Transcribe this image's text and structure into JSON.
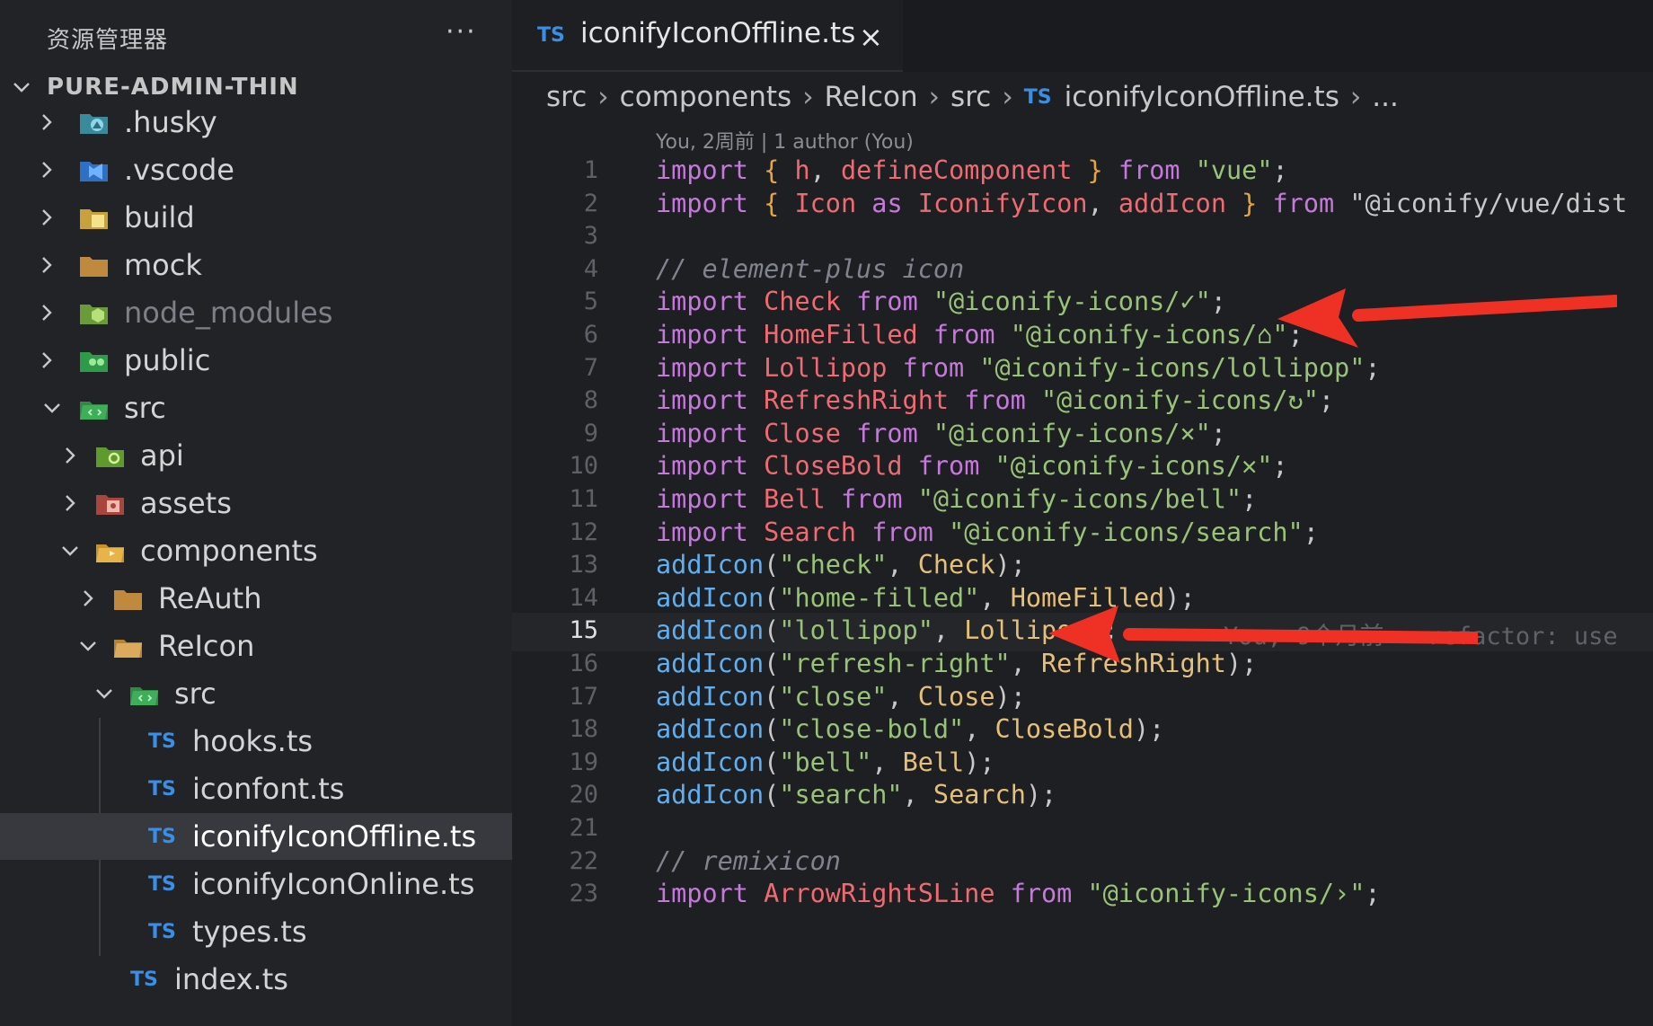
{
  "sidebar": {
    "title": "资源管理器",
    "more": "···",
    "root": "PURE-ADMIN-THIN",
    "items": [
      {
        "label": ".husky",
        "kind": "folder",
        "expanded": false
      },
      {
        "label": ".vscode",
        "kind": "folder",
        "expanded": false
      },
      {
        "label": "build",
        "kind": "folder",
        "expanded": false
      },
      {
        "label": "mock",
        "kind": "folder",
        "expanded": false
      },
      {
        "label": "node_modules",
        "kind": "folder",
        "expanded": false
      },
      {
        "label": "public",
        "kind": "folder",
        "expanded": false
      },
      {
        "label": "src",
        "kind": "folder",
        "expanded": true
      },
      {
        "label": "api",
        "kind": "folder",
        "expanded": false
      },
      {
        "label": "assets",
        "kind": "folder",
        "expanded": false
      },
      {
        "label": "components",
        "kind": "folder",
        "expanded": true
      },
      {
        "label": "ReAuth",
        "kind": "folder",
        "expanded": false
      },
      {
        "label": "ReIcon",
        "kind": "folder",
        "expanded": true
      },
      {
        "label": "src",
        "kind": "folder",
        "expanded": true
      },
      {
        "label": "hooks.ts",
        "kind": "file"
      },
      {
        "label": "iconfont.ts",
        "kind": "file"
      },
      {
        "label": "iconifyIconOffline.ts",
        "kind": "file",
        "selected": true
      },
      {
        "label": "iconifyIconOnline.ts",
        "kind": "file"
      },
      {
        "label": "types.ts",
        "kind": "file"
      },
      {
        "label": "index.ts",
        "kind": "file"
      }
    ],
    "ts_badge": "TS"
  },
  "editor": {
    "tab": {
      "label": "iconifyIconOffline.ts",
      "close": "×"
    },
    "breadcrumb": [
      "src",
      "components",
      "ReIcon",
      "src",
      "iconifyIconOffline.ts",
      "..."
    ],
    "codelens": "You, 2周前 | 1 author (You)",
    "current_line": 15,
    "blame": "You, 9个月前 • refactor: use",
    "lines": [
      "import { h, defineComponent } from \"vue\";",
      "import { Icon as IconifyIcon, addIcon } from \"@iconify/vue/dist",
      "",
      "// element-plus icon",
      "import Check from \"@iconify-icons/✓\";",
      "import HomeFilled from \"@iconify-icons/⌂\";",
      "import Lollipop from \"@iconify-icons/lollipop\";",
      "import RefreshRight from \"@iconify-icons/↻\";",
      "import Close from \"@iconify-icons/×\";",
      "import CloseBold from \"@iconify-icons/✕\";",
      "import Bell from \"@iconify-icons/bell\";",
      "import Search from \"@iconify-icons/search\";",
      "addIcon(\"check\", Check);",
      "addIcon(\"home-filled\", HomeFilled);",
      "addIcon(\"lollipop\", Lollipop);",
      "addIcon(\"refresh-right\", RefreshRight);",
      "addIcon(\"close\", Close);",
      "addIcon(\"close-bold\", CloseBold);",
      "addIcon(\"bell\", Bell);",
      "addIcon(\"search\", Search);",
      "",
      "// remixicon",
      "import ArrowRightSLine from \"@iconify-icons/›\";"
    ]
  },
  "annotations": {
    "arrow_color": "#ee3124",
    "arrows": 2
  },
  "colors": {
    "keyword": "#c678dd",
    "identifier": "#ef6b73",
    "string": "#98c379",
    "function": "#61afef",
    "variable": "#e5c07b",
    "ts": "#3a8ee6"
  }
}
